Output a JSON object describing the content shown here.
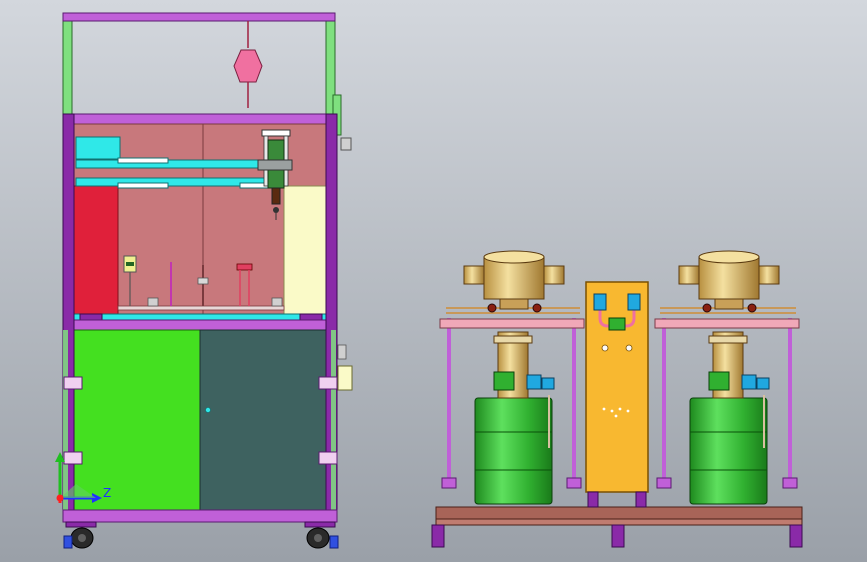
{
  "viewport": {
    "background_top": "#d3d7dd",
    "background_bottom": "#9aa0a8"
  },
  "axis_triad": {
    "z_label": "Z",
    "x_color": "#ff2020",
    "y_color": "#20c020",
    "z_color": "#2030ff"
  },
  "palette": {
    "frame_purple": "#8a2aa8",
    "frame_light_purple": "#c060d8",
    "frame_green": "#7fe07f",
    "panel_rose": "#c8787c",
    "panel_red": "#e0203a",
    "panel_cream": "#fafac8",
    "panel_green": "#44e020",
    "panel_slate": "#3e6260",
    "cyan_rail": "#2fe8e8",
    "pink_weight": "#f070a0",
    "drum_green": "#30b030",
    "brass": "#d8b860",
    "cabinet_orange": "#f8b830",
    "base_brown": "#a86458",
    "pink_bar": "#f0a8b8"
  }
}
